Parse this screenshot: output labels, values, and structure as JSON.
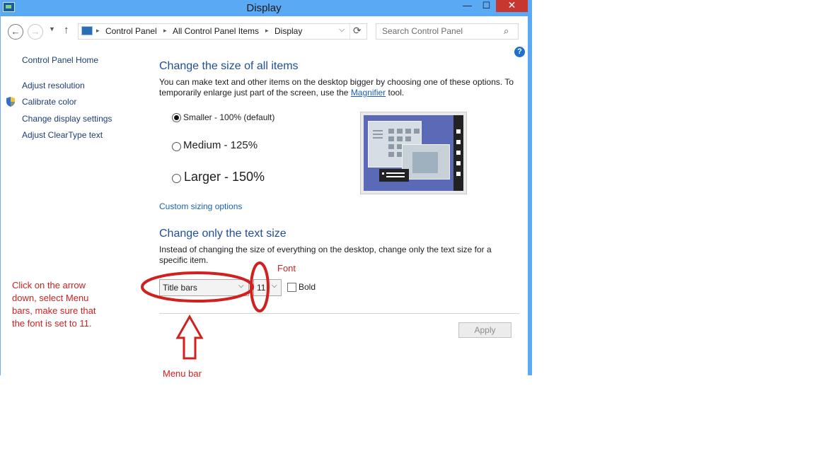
{
  "window": {
    "title": "Display",
    "minimize_glyph": "—",
    "maximize_glyph": "☐",
    "close_glyph": "✕"
  },
  "navigation": {
    "back_glyph": "←",
    "forward_glyph": "→",
    "recent_glyph": "▼",
    "up_glyph": "↑",
    "breadcrumbs": [
      "Control Panel",
      "All Control Panel Items",
      "Display"
    ],
    "breadcrumb_sep": "▸",
    "dropdown_glyph": "⌵",
    "refresh_glyph": "⟳",
    "search_placeholder": "Search Control Panel",
    "search_glyph": "⌕"
  },
  "help_glyph": "?",
  "sidebar": {
    "home": "Control Panel Home",
    "items": [
      "Adjust resolution",
      "Calibrate color",
      "Change display settings",
      "Adjust ClearType text"
    ]
  },
  "section_size": {
    "heading": "Change the size of all items",
    "desc_part1": "You can make text and other items on the desktop bigger by choosing one of these options. To temporarily enlarge just part of the screen, use the ",
    "magnifier_link": "Magnifier",
    "desc_part2": " tool.",
    "options": [
      {
        "label": "Smaller - 100% (default)",
        "checked": true
      },
      {
        "label": "Medium - 125%",
        "checked": false
      },
      {
        "label": "Larger - 150%",
        "checked": false
      }
    ],
    "custom_link": "Custom sizing options"
  },
  "section_text": {
    "heading": "Change only the text size",
    "desc": "Instead of changing the size of everything on the desktop, change only the text size for a specific item.",
    "item_value": "Title bars",
    "size_value": "11",
    "select_arrow": "⌵",
    "bold_label": "Bold",
    "bold_checked": false,
    "apply_label": "Apply"
  },
  "annotations": {
    "instruction_lines": [
      "Click on the arrow",
      "down, select Menu",
      "bars, make sure that",
      "the font is set to 11."
    ],
    "font_label": "Font",
    "menu_bar_label": "Menu bar",
    "color": "#d21f1f"
  }
}
